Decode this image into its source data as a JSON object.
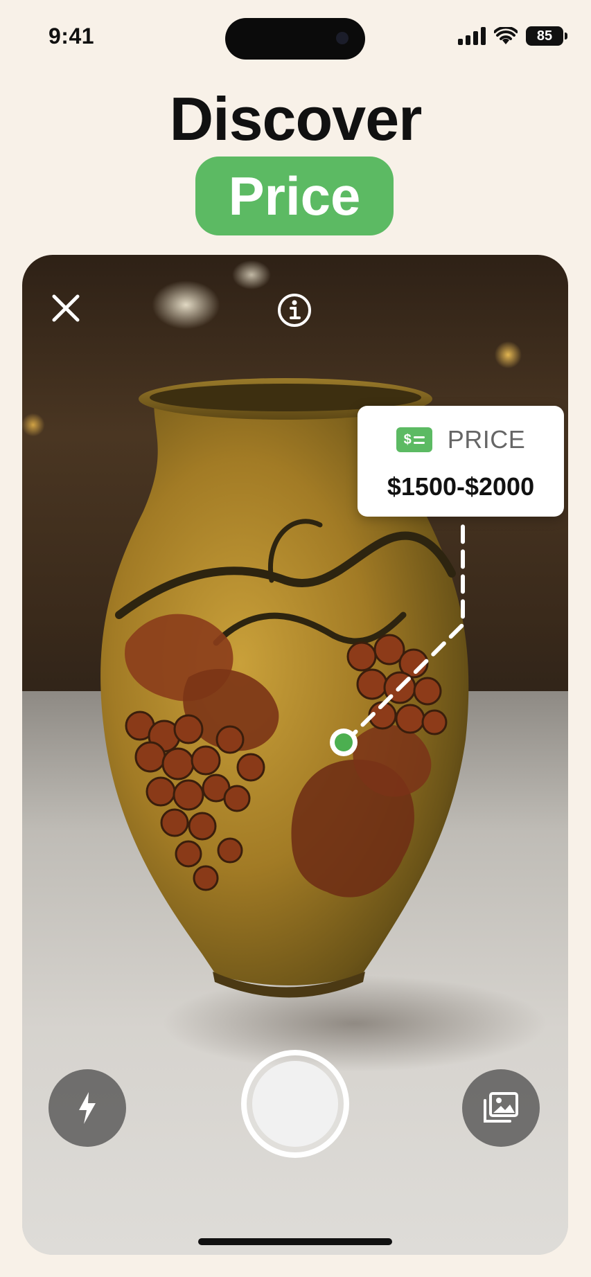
{
  "status_bar": {
    "time": "9:41",
    "battery_level": "85",
    "icons": [
      "signal-icon",
      "wifi-icon",
      "battery-icon"
    ]
  },
  "headline": {
    "title": "Discover",
    "highlight": "Price",
    "highlight_color": "#5cba63"
  },
  "camera": {
    "top_controls": [
      "close-icon",
      "info-icon"
    ],
    "price_tag": {
      "icon": "money-icon",
      "label": "PRICE",
      "value": "$1500-$2000"
    },
    "bottom_controls": [
      "flash-icon",
      "shutter-button",
      "gallery-icon"
    ]
  },
  "colors": {
    "background": "#f8f1e8",
    "accent_green": "#5cba63",
    "text_dark": "#111111"
  }
}
